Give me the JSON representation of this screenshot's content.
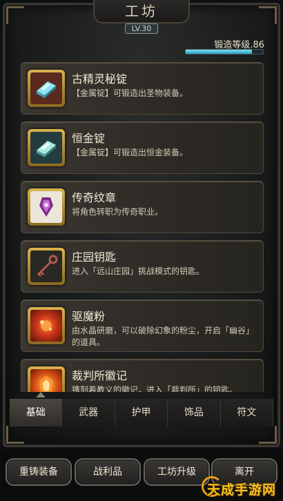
{
  "header": {
    "title": "工坊",
    "level": "LV.30"
  },
  "forge": {
    "label": "锻造等级.86",
    "progress": 0.86
  },
  "items": [
    {
      "name": "古精灵秘锭",
      "desc": "【金属锭】可锻造出圣物装备。",
      "icon": "elven-ingot-icon"
    },
    {
      "name": "恒金锭",
      "desc": "【金属锭】可锻造出恒金装备。",
      "icon": "eternal-gold-ingot-icon"
    },
    {
      "name": "传奇纹章",
      "desc": "将角色转职为传奇职业。",
      "icon": "legend-emblem-icon"
    },
    {
      "name": "庄园钥匙",
      "desc": "进入「远山庄园」挑战模式的钥匙。",
      "icon": "manor-key-icon"
    },
    {
      "name": "驱魔粉",
      "desc": "由水晶研磨，可以破除幻象的粉尘，开启「幽谷」的道具。",
      "icon": "exorcism-powder-icon"
    },
    {
      "name": "裁判所徽记",
      "desc": "镌刻着教义的徽记，进入「裁判所」的钥匙。",
      "icon": "tribunal-emblem-icon"
    }
  ],
  "tabs": [
    "基础",
    "武器",
    "护甲",
    "饰品",
    "符文"
  ],
  "active_tab": "基础",
  "buttons": {
    "recast": "重铸装备",
    "loot": "战利品",
    "upgrade": "工坊升级",
    "leave": "离开"
  },
  "watermark": "天成手游网"
}
